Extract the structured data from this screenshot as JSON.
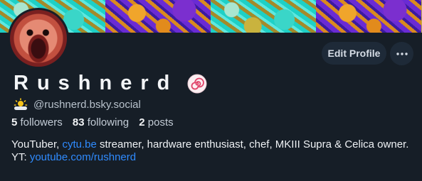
{
  "profile": {
    "display_name": "Rushnerd",
    "handle": "@rushnerd.bsky.social",
    "followers_count": "5",
    "followers_label": "followers",
    "following_count": "83",
    "following_label": "following",
    "posts_count": "2",
    "posts_label": "posts"
  },
  "actions": {
    "edit_label": "Edit Profile",
    "more_label": "···"
  },
  "bio": {
    "line1_pre": "YouTuber, ",
    "line1_link": "cytu.be",
    "line1_post": " streamer, hardware enthusiast, chef, MKIII Supra & Celica owner.",
    "line2_pre": "YT: ",
    "line2_link": "youtube.com/rushnerd"
  },
  "icons": {
    "name_emoji": "naruto-fishcake-icon",
    "handle_emoji": "sun-behind-small-cloud-icon",
    "more": "ellipsis-icon"
  },
  "colors": {
    "background": "#161e27",
    "button_bg": "#1e2a38",
    "link": "#2f8bff",
    "muted_text": "#b8c2cc"
  }
}
